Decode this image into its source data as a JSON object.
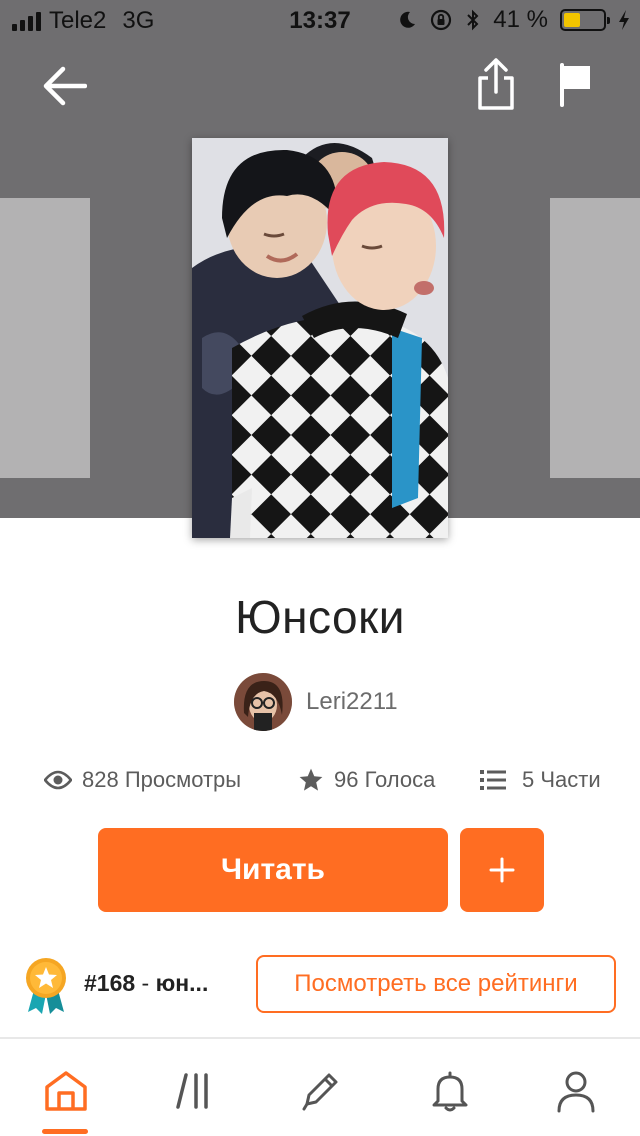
{
  "status_bar": {
    "carrier": "Tele2",
    "network": "3G",
    "time": "13:37",
    "battery_percent": "41 %",
    "battery_level": 0.41
  },
  "top_bar": {
    "back_icon": "arrow-left-icon",
    "share_icon": "share-icon",
    "report_icon": "flag-icon"
  },
  "story": {
    "title": "Юнсоки",
    "author": "Leri2211"
  },
  "stats": {
    "views": "828 Просмотры",
    "votes": "96 Голоса",
    "parts": "5 Части"
  },
  "actions": {
    "read_label": "Читать",
    "add_label": "+"
  },
  "ranking": {
    "rank": "#168",
    "separator": " - ",
    "tag": "юн...",
    "view_all_label": "Посмотреть все рейтинги"
  },
  "bottom_nav": {
    "items": [
      "home-icon",
      "library-icon",
      "write-icon",
      "notifications-icon",
      "profile-icon"
    ],
    "active": "home-icon"
  },
  "colors": {
    "accent": "#ff6d22",
    "header_bg": "#6f6e70",
    "side_card": "#b3b2b3"
  }
}
